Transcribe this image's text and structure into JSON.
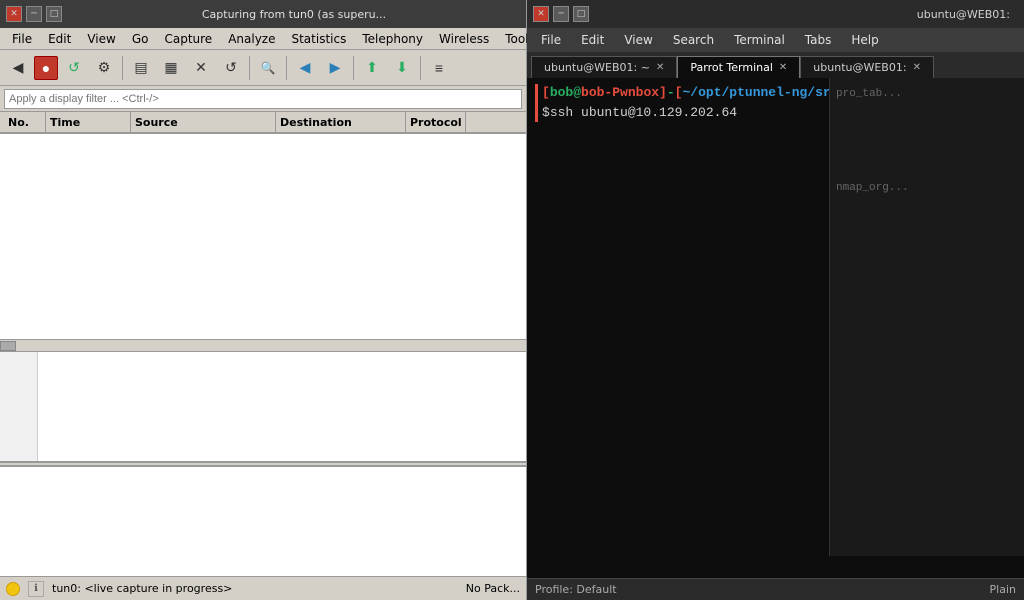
{
  "wireshark": {
    "titlebar": {
      "title": "Capturing from tun0 (as superu...",
      "close": "✕",
      "minimize": "─",
      "maximize": "□"
    },
    "menu": {
      "items": [
        "File",
        "Edit",
        "View",
        "Go",
        "Capture",
        "Analyze",
        "Statistics",
        "Telephony",
        "Wireless",
        "Tools"
      ]
    },
    "toolbar": {
      "buttons": [
        {
          "icon": "◀",
          "label": "back",
          "style": "normal"
        },
        {
          "icon": "●",
          "label": "stop-capture",
          "style": "red"
        },
        {
          "icon": "↺",
          "label": "restart",
          "style": "green"
        },
        {
          "icon": "⚙",
          "label": "options",
          "style": "normal"
        },
        {
          "icon": "▤",
          "label": "open",
          "style": "normal"
        },
        {
          "icon": "▦",
          "label": "save",
          "style": "normal"
        },
        {
          "icon": "✕",
          "label": "close",
          "style": "normal"
        },
        {
          "icon": "↺",
          "label": "reload",
          "style": "normal"
        },
        {
          "icon": "🔍",
          "label": "find",
          "style": "normal"
        },
        {
          "icon": "◀",
          "label": "prev",
          "style": "blue"
        },
        {
          "icon": "▶",
          "label": "next",
          "style": "blue"
        },
        {
          "icon": "⬆",
          "label": "scroll-up",
          "style": "green"
        },
        {
          "icon": "⬇",
          "label": "scroll-down",
          "style": "green"
        }
      ]
    },
    "filter": {
      "placeholder": "Apply a display filter ... <Ctrl-/>",
      "value": ""
    },
    "columns": {
      "no": "No.",
      "time": "Time",
      "source": "Source",
      "destination": "Destination",
      "protocol": "Protocol"
    },
    "status": {
      "live": "tun0: <live capture in progress>",
      "packets": "No Pack..."
    }
  },
  "terminal": {
    "titlebar": {
      "title": "ubuntu@WEB01:",
      "active_tab": "Parrot Terminal",
      "right_tab": "ubuntu@WEB01:"
    },
    "menu": {
      "items": [
        "File",
        "Edit",
        "View",
        "Search",
        "Terminal",
        "Tabs",
        "Help"
      ]
    },
    "tabs": [
      {
        "label": "ubuntu@WEB01: ~",
        "active": false
      },
      {
        "label": "Parrot Terminal",
        "active": true
      },
      {
        "label": "ubuntu@WEB01:",
        "active": false
      }
    ],
    "prompt": {
      "user": "bob",
      "at": "@",
      "host": "bob-Pwnbox",
      "separator": "-",
      "bracket_open": "[",
      "bracket_close": "]",
      "path": "~/opt/ptunnel-ng/src",
      "dollar": "$",
      "command": "ssh ubuntu@10.129.202.64"
    },
    "right_panel": {
      "items": [
        "pro_tab",
        "nmap_org"
      ]
    },
    "statusbar": {
      "profile": "Profile: Default",
      "encoding": "Plain"
    }
  }
}
